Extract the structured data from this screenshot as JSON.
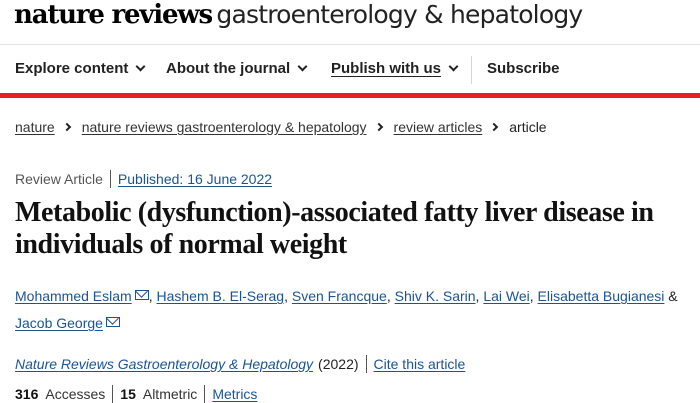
{
  "header": {
    "brand": "nature reviews",
    "journal": "gastroenterology & hepatology"
  },
  "nav": {
    "items": [
      {
        "label": "Explore content"
      },
      {
        "label": "About the journal"
      },
      {
        "label": "Publish with us"
      },
      {
        "label": "Subscribe"
      }
    ]
  },
  "breadcrumb": {
    "items": [
      "nature",
      "nature reviews gastroenterology & hepatology",
      "review articles"
    ],
    "current": "article"
  },
  "article": {
    "type": "Review Article",
    "published": "Published: 16 June 2022",
    "title": "Metabolic (dysfunction)-associated fatty liver disease in individuals of normal weight",
    "authors": [
      "Mohammed Eslam",
      "Hashem B. El-Serag",
      "Sven Francque",
      "Shiv K. Sarin",
      "Lai Wei",
      "Elisabetta Bugianesi",
      "Jacob George"
    ],
    "journal_name": "Nature Reviews Gastroenterology & Hepatology",
    "year": "(2022)",
    "cite_label": "Cite this article",
    "accesses_count": "316",
    "accesses_label": "Accesses",
    "altmetric_count": "15",
    "altmetric_label": "Altmetric",
    "metrics_label": "Metrics"
  },
  "icons": {
    "email": "envelope-icon",
    "chevron": "chevron-down-icon",
    "breadcrumb_sep": "chevron-right-icon"
  },
  "colors": {
    "accent_red": "#e2231a",
    "link_blue": "#1a5493"
  }
}
